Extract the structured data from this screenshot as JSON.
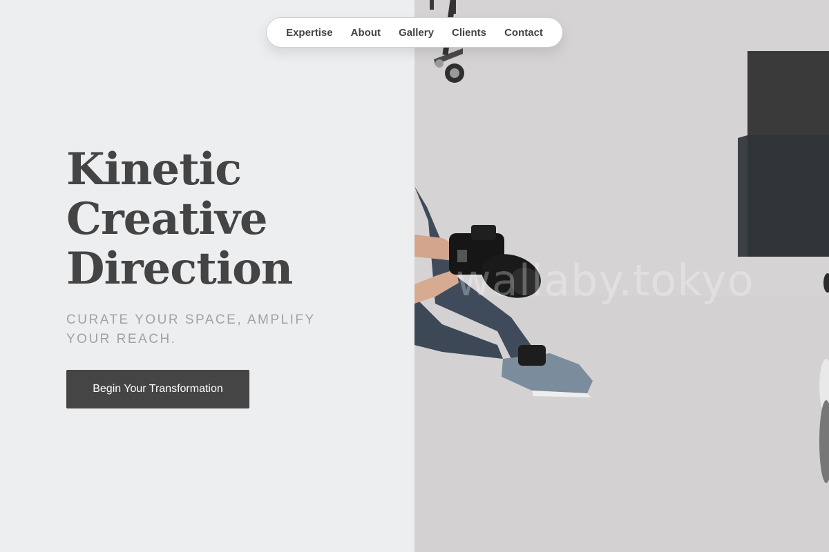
{
  "nav": {
    "items": [
      {
        "label": "Expertise"
      },
      {
        "label": "About"
      },
      {
        "label": "Gallery"
      },
      {
        "label": "Clients"
      },
      {
        "label": "Contact"
      }
    ]
  },
  "hero": {
    "title_lines": [
      "Kinetic",
      "Creative",
      "Direction"
    ],
    "subtitle": "CURATE YOUR SPACE, AMPLIFY YOUR REACH.",
    "cta_label": "Begin Your Transformation"
  },
  "image": {
    "watermark": "wallaby.tokyo",
    "description_icon": "photographer-photo"
  },
  "colors": {
    "left_bg": "#edeef0",
    "text_dark": "#444444",
    "subtitle": "#a2a2a2",
    "button_bg": "#454545"
  }
}
